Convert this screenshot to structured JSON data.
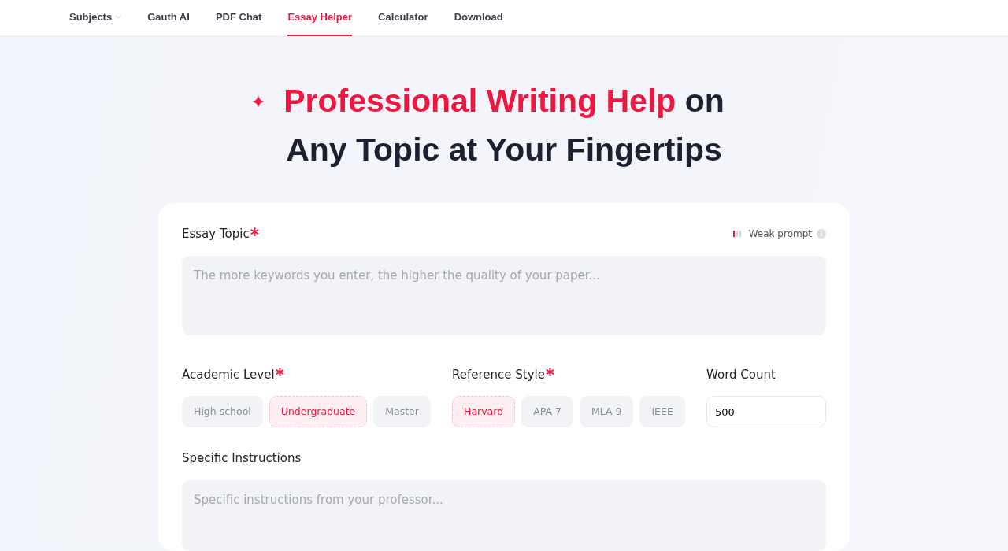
{
  "nav": [
    {
      "label": "Subjects",
      "dropdown": true,
      "selected": false
    },
    {
      "label": "Gauth AI",
      "dropdown": false,
      "selected": false
    },
    {
      "label": "PDF Chat",
      "dropdown": false,
      "selected": false
    },
    {
      "label": "Essay Helper",
      "dropdown": false,
      "selected": true
    },
    {
      "label": "Calculator",
      "dropdown": false,
      "selected": false
    },
    {
      "label": "Download",
      "dropdown": false,
      "selected": false
    }
  ],
  "headline": {
    "accent": "Professional Writing Help",
    "rest": "on Any Topic at Your Fingertips"
  },
  "topic": {
    "label": "Essay Topic",
    "required": true,
    "strength": {
      "label": "Weak prompt",
      "level": 0.33
    },
    "placeholder": "The more keywords you enter, the higher the quality of your paper..."
  },
  "academic_level": {
    "label": "Academic Level",
    "required": true,
    "options": [
      {
        "label": "High school",
        "selected": false
      },
      {
        "label": "Undergraduate",
        "selected": true
      },
      {
        "label": "Master",
        "selected": false
      }
    ]
  },
  "reference_style": {
    "label": "Reference Style",
    "required": true,
    "options": [
      {
        "label": "Harvard",
        "selected": true
      },
      {
        "label": "APA 7",
        "selected": false
      },
      {
        "label": "MLA 9",
        "selected": false
      },
      {
        "label": "IEEE",
        "selected": false
      }
    ]
  },
  "word_count": {
    "label": "Word Count",
    "value": "500"
  },
  "instructions": {
    "label": "Specific Instructions",
    "placeholder": "Specific instructions from your professor..."
  }
}
